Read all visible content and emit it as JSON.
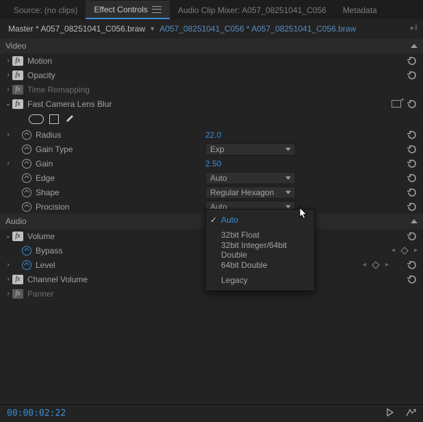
{
  "tabs": {
    "source": "Source: (no clips)",
    "effect_controls": "Effect Controls",
    "audio_mixer": "Audio Clip Mixer: A057_08251041_C056",
    "metadata": "Metadata"
  },
  "breadcrumb": {
    "master": "Master * A057_08251041_C056.braw",
    "clip": "A057_08251041_C056 * A057_08251041_C056.braw"
  },
  "sections": {
    "video": "Video",
    "audio": "Audio"
  },
  "effects": {
    "motion": {
      "label": "Motion"
    },
    "opacity": {
      "label": "Opacity"
    },
    "time_remapping": {
      "label": "Time Remapping"
    },
    "fast_blur": {
      "label": "Fast Camera Lens Blur",
      "props": {
        "radius": {
          "label": "Radius",
          "value": "22.0"
        },
        "gain_type": {
          "label": "Gain Type",
          "value": "Exp"
        },
        "gain": {
          "label": "Gain",
          "value": "2.50"
        },
        "edge": {
          "label": "Edge",
          "value": "Auto"
        },
        "shape": {
          "label": "Shape",
          "value": "Regular Hexagon"
        },
        "procision": {
          "label": "Procision",
          "value": "Auto"
        }
      }
    },
    "volume": {
      "label": "Volume",
      "props": {
        "bypass": {
          "label": "Bypass"
        },
        "level": {
          "label": "Level"
        }
      }
    },
    "channel_volume": {
      "label": "Channel Volume"
    },
    "panner": {
      "label": "Panner"
    }
  },
  "popup": {
    "items": [
      "Auto",
      "32bit Float",
      "32bit Integer/64bit Double",
      "64bit Double",
      "Legacy"
    ],
    "selected": "Auto"
  },
  "timecode": "00:00:02:22"
}
